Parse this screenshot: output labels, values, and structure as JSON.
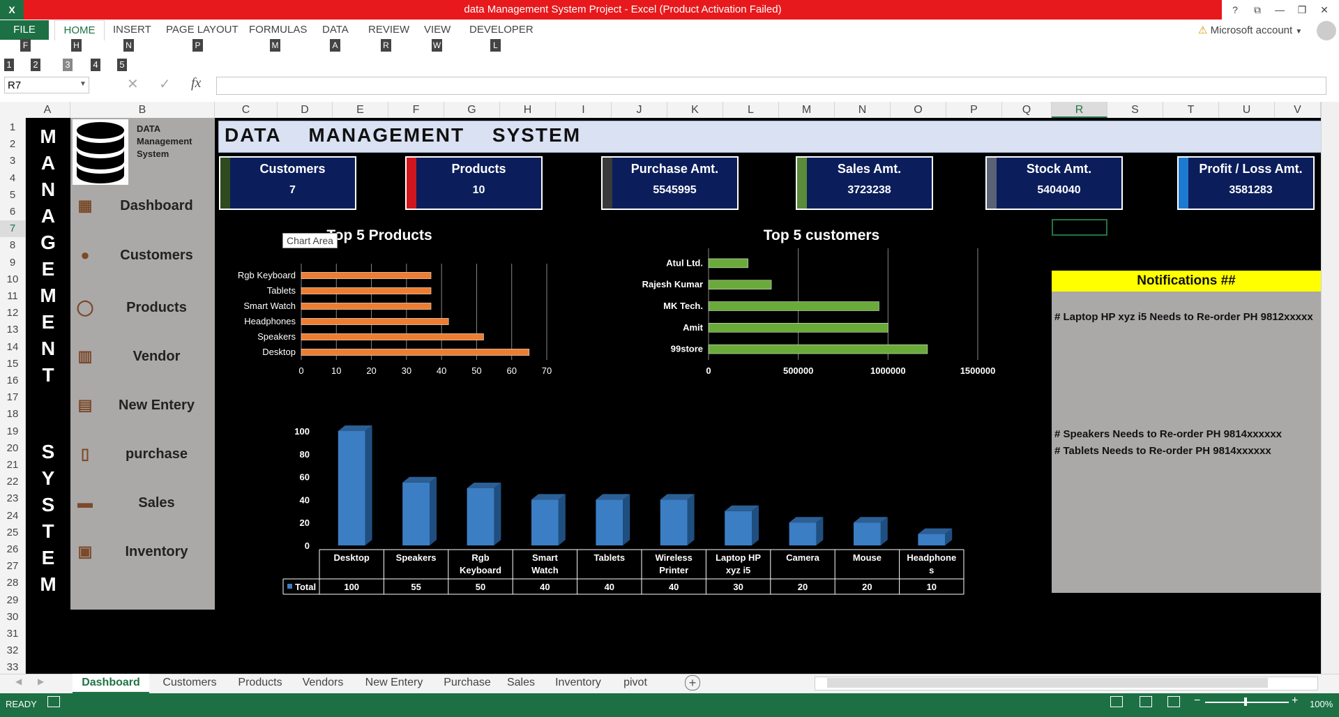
{
  "window": {
    "title": "data Management System Project -  Excel (Product Activation Failed)",
    "account": "Microsoft account",
    "help_icon": "?",
    "controls": [
      "restore-icon",
      "minimize-icon",
      "maximize-icon",
      "close-icon"
    ]
  },
  "ribbon": {
    "tabs": [
      {
        "label": "FILE",
        "key": "F"
      },
      {
        "label": "HOME",
        "key": "H"
      },
      {
        "label": "INSERT",
        "key": "N"
      },
      {
        "label": "PAGE LAYOUT",
        "key": "P"
      },
      {
        "label": "FORMULAS",
        "key": "M"
      },
      {
        "label": "DATA",
        "key": "A"
      },
      {
        "label": "REVIEW",
        "key": "R"
      },
      {
        "label": "VIEW",
        "key": "W"
      },
      {
        "label": "DEVELOPER",
        "key": "L"
      }
    ],
    "qat_keys": [
      "1",
      "2",
      "3",
      "4",
      "5"
    ]
  },
  "formula_bar": {
    "name_box": "R7",
    "fx_label": "fx",
    "value": ""
  },
  "columns": [
    "A",
    "B",
    "C",
    "D",
    "E",
    "F",
    "G",
    "H",
    "I",
    "J",
    "K",
    "L",
    "M",
    "N",
    "O",
    "P",
    "Q",
    "R",
    "S",
    "T",
    "U",
    "V"
  ],
  "rows": [
    "1",
    "2",
    "3",
    "4",
    "5",
    "6",
    "7",
    "8",
    "9",
    "10",
    "11",
    "12",
    "13",
    "14",
    "15",
    "16",
    "17",
    "18",
    "19",
    "20",
    "21",
    "22",
    "23",
    "24",
    "25",
    "26",
    "27",
    "28",
    "29",
    "30",
    "31",
    "32",
    "33"
  ],
  "vertical_word_1": [
    "M",
    "A",
    "N",
    "A",
    "G",
    "E",
    "M",
    "E",
    "N",
    "T"
  ],
  "vertical_word_2": [
    "S",
    "Y",
    "S",
    "T",
    "E",
    "M"
  ],
  "sidebar": {
    "logo_text": "DATA Management System",
    "items": [
      {
        "label": "Dashboard",
        "icon": "presentation-icon"
      },
      {
        "label": "Customers",
        "icon": "person-icon"
      },
      {
        "label": "Products",
        "icon": "user-outline-icon"
      },
      {
        "label": "Vendor",
        "icon": "boxes-icon"
      },
      {
        "label": "New Entery",
        "icon": "brick-wall-icon"
      },
      {
        "label": "purchase",
        "icon": "receipt-icon"
      },
      {
        "label": "Sales",
        "icon": "cash-register-icon"
      },
      {
        "label": "Inventory",
        "icon": "clipboard-icon"
      }
    ]
  },
  "header": {
    "title": "DATA   MANAGEMENT   SYSTEM"
  },
  "cards": [
    {
      "title": "Customers",
      "value": "7",
      "stripe": "#2e4a1e"
    },
    {
      "title": "Products",
      "value": "10",
      "stripe": "#d0161c"
    },
    {
      "title": "Purchase Amt.",
      "value": "5545995",
      "stripe": "#3a3a3a"
    },
    {
      "title": "Sales Amt.",
      "value": "3723238",
      "stripe": "#5a8a3a"
    },
    {
      "title": "Stock Amt.",
      "value": "5404040",
      "stripe": "#5a6275"
    },
    {
      "title": "Profit / Loss Amt.",
      "value": "3581283",
      "stripe": "#1e7ad0"
    }
  ],
  "chart_tooltip": "Chart Area",
  "chart_data": [
    {
      "type": "bar",
      "orientation": "horizontal",
      "title": "Top 5 Products",
      "categories": [
        "Rgb Keyboard",
        "Tablets",
        "Smart Watch",
        "Headphones",
        "Speakers",
        "Desktop"
      ],
      "values": [
        37,
        37,
        37,
        42,
        52,
        65
      ],
      "xlim": [
        0,
        70
      ],
      "xticks": [
        "0",
        "10",
        "20",
        "30",
        "40",
        "50",
        "60",
        "70"
      ],
      "color": "#ed7d31",
      "grid": true
    },
    {
      "type": "bar",
      "orientation": "horizontal",
      "title": "Top 5 customers",
      "categories": [
        "Atul Ltd.",
        "Rajesh Kumar",
        "MK Tech.",
        "Amit",
        "99store"
      ],
      "values": [
        220000,
        350000,
        950000,
        1000000,
        1220000
      ],
      "xlim": [
        0,
        1500000
      ],
      "xticks": [
        "0",
        "500000",
        "1000000",
        "1500000"
      ],
      "color": "#6aaa3a",
      "grid": true
    },
    {
      "type": "bar",
      "title": "",
      "categories": [
        "Desktop",
        "Speakers",
        "Rgb Keyboard",
        "Smart Watch",
        "Tablets",
        "Wireless Printer",
        "Laptop HP xyz i5",
        "Camera",
        "Mouse",
        "Headphones"
      ],
      "series": [
        {
          "name": "Total",
          "values": [
            100,
            55,
            50,
            40,
            40,
            40,
            30,
            20,
            20,
            10
          ]
        }
      ],
      "ylim": [
        0,
        100
      ],
      "yticks": [
        "0",
        "20",
        "40",
        "60",
        "80",
        "100"
      ],
      "color": "#3c7ec4",
      "data_table": true
    }
  ],
  "notifications": {
    "title": "Notifications ##",
    "lines": [
      "# Laptop HP xyz i5 Needs to Re-order PH 9812xxxxx",
      "# Speakers Needs to Re-order PH 9814xxxxxx",
      "# Tablets Needs to Re-order PH 9814xxxxxx"
    ]
  },
  "sheet_tabs": [
    "Dashboard",
    "Customers",
    "Products",
    "Vendors",
    "New Entery",
    "Purchase",
    "Sales",
    "Inventory",
    "pivot"
  ],
  "active_sheet": "Dashboard",
  "status": {
    "ready": "READY",
    "zoom": "100%"
  }
}
